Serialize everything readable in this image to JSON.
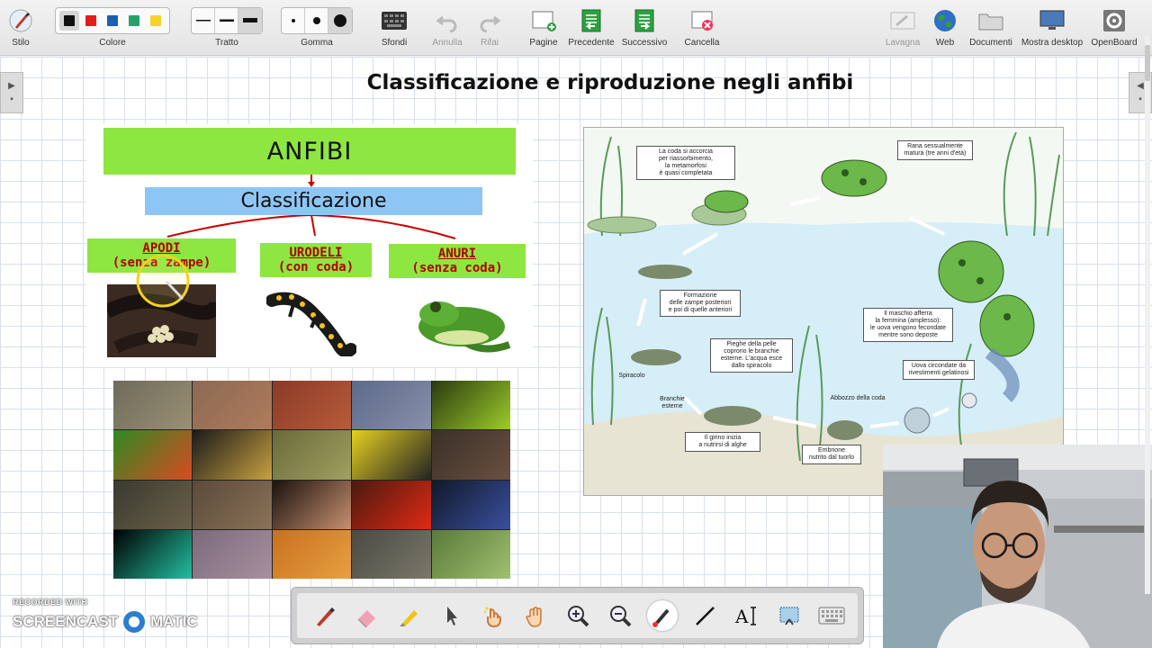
{
  "toolbar": {
    "stylus": "Stilo",
    "color": "Colore",
    "stroke": "Tratto",
    "eraser": "Gomma",
    "backgrounds": "Sfondi",
    "undo": "Annulla",
    "redo": "Rifai",
    "pages": "Pagine",
    "previous": "Precedente",
    "next": "Successivo",
    "clear": "Cancella",
    "board": "Lavagna",
    "web": "Web",
    "documents": "Documenti",
    "desktop": "Mostra desktop",
    "openboard": "OpenBoard"
  },
  "colors": [
    "#111111",
    "#e51c1c",
    "#1a5fb4",
    "#26a269",
    "#f6d32d"
  ],
  "page_title": "Classificazione e riproduzione negli anfibi",
  "slide_left": {
    "title": "ANFIBI",
    "classification": "Classificazione",
    "categories": [
      {
        "name": "APODI",
        "desc": "(senza zampe)"
      },
      {
        "name": "URODELI",
        "desc": "(con coda)"
      },
      {
        "name": "ANURI",
        "desc": "(senza coda)"
      }
    ]
  },
  "diagram": {
    "notes": [
      "La coda si accorcia\nper riassorbimento,\nla metamorfosi\nè quasi completata",
      "Rana sessualmente\nmatura (tre anni d'età)",
      "Formazione\ndelle zampe posteriori\ne poi di quelle anteriori",
      "Il maschio afferra\nla femmina (amplesso):\nle uova vengono fecondate\nmentre sono deposte",
      "Pieghe della pelle\ncoprono le branchie\nesterne. L'acqua esce\ndallo spiracolo",
      "Uova circondate da\nrivestimenti gelatinosi",
      "Il girino inizia\na nutrirsi di alghe",
      "Embrione\nnutrito dal tuorlo"
    ],
    "labels": [
      "Spiracolo",
      "Branchie\nesterne",
      "Abbozzo della coda"
    ]
  },
  "watermark": {
    "line1": "RECORDED WITH",
    "line2a": "SCREENCAST",
    "line2b": "MATIC"
  }
}
